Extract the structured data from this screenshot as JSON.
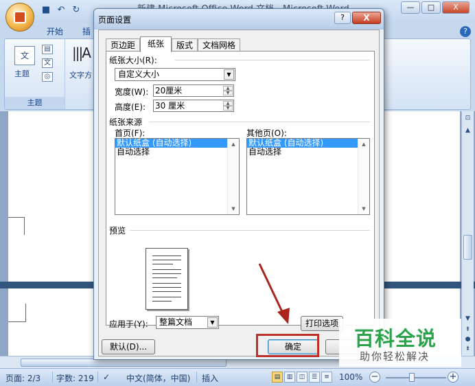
{
  "word": {
    "title": "新建 Microsoft Office Word 文档 - Microsoft Word",
    "tabs": [
      "开始",
      "插"
    ],
    "ribbon": {
      "theme_icon_text": "文",
      "theme_label": "主题",
      "theme_group_label": "主题",
      "text_direction_label": "文字方"
    },
    "status": {
      "page": "页面: 2/3",
      "words": "字数: 219",
      "language": "中文(简体，中国)",
      "mode": "插入",
      "zoom": "100%"
    }
  },
  "dialog": {
    "title": "页面设置",
    "help": "?",
    "close": "X",
    "tabs": [
      "页边距",
      "纸张",
      "版式",
      "文档网格"
    ],
    "active_tab": 1,
    "paper_size_label": "纸张大小(R):",
    "paper_size_value": "自定义大小",
    "width_label": "宽度(W):",
    "width_value": "20厘米",
    "height_label": "高度(E):",
    "height_value": "30 厘米",
    "paper_source_label": "纸张来源",
    "first_page_label": "首页(F):",
    "other_pages_label": "其他页(O):",
    "first_page_items": [
      "默认纸盒 (自动选择)",
      "自动选择"
    ],
    "other_pages_items": [
      "默认纸盒 (自动选择)",
      "自动选择"
    ],
    "preview_label": "预览",
    "apply_to_label": "应用于(Y):",
    "apply_to_value": "整篇文档",
    "print_options_button": "打印选项",
    "default_button": "默认(D)...",
    "ok_button": "确定"
  },
  "watermark": {
    "brand": "百科全说",
    "sub": "助你轻松解决"
  },
  "colors": {
    "annotation": "#c0302a",
    "selection": "#3399ff",
    "watermark_green": "#2aa34a"
  }
}
